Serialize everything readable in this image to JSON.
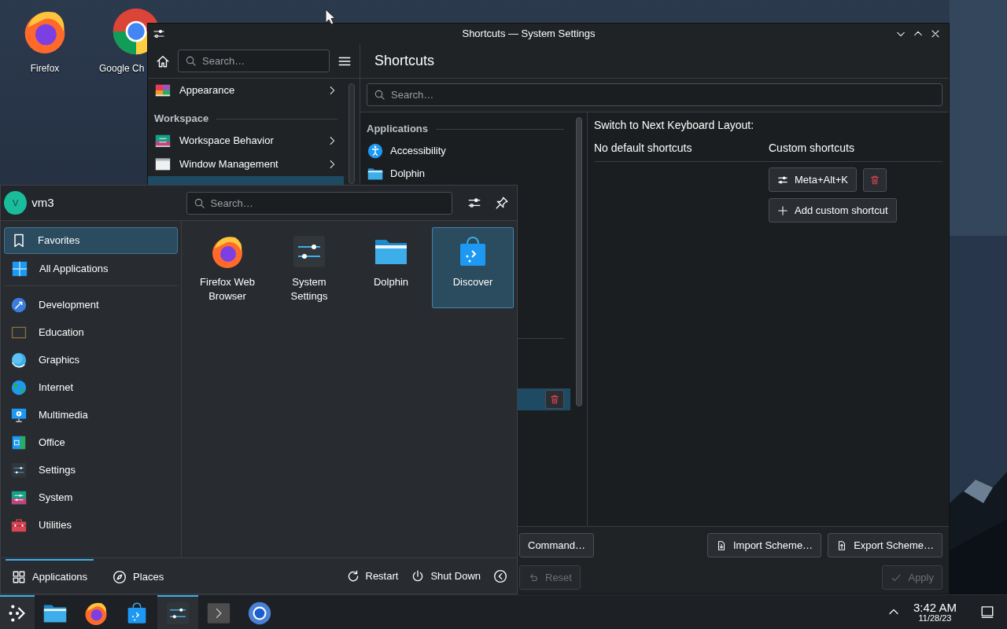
{
  "desktop_icons": [
    {
      "label": "Firefox"
    },
    {
      "label": "Google Ch"
    }
  ],
  "settings": {
    "title": "Shortcuts — System Settings",
    "sidebar": {
      "search": {
        "placeholder": "Search…"
      },
      "items": [
        {
          "kind": "item",
          "label": "Appearance",
          "selected": false
        },
        {
          "kind": "header",
          "label": "Workspace"
        },
        {
          "kind": "item",
          "label": "Workspace Behavior",
          "selected": false
        },
        {
          "kind": "item",
          "label": "Window Management",
          "selected": false
        },
        {
          "kind": "item",
          "selected": true
        }
      ]
    },
    "page_title": "Shortcuts",
    "search": {
      "placeholder": "Search…"
    },
    "components": [
      {
        "kind": "header",
        "label": "Applications"
      },
      {
        "kind": "app",
        "label": "Accessibility",
        "selected": false
      },
      {
        "kind": "app",
        "label": "Dolphin",
        "selected": false
      },
      {
        "kind": "header"
      },
      {
        "kind": "shortcut",
        "selected": true
      }
    ],
    "details": {
      "title": "Switch to Next Keyboard Layout:",
      "default_heading": "No default shortcuts",
      "custom_heading": "Custom shortcuts",
      "shortcuts": [
        {
          "keys": "Meta+Alt+K"
        }
      ],
      "add_label": "Add custom shortcut"
    },
    "footer": [
      {
        "kind": "left",
        "label": "Command…",
        "disabled": false
      },
      {
        "kind": "import",
        "label": "Import Scheme…",
        "disabled": false
      },
      {
        "kind": "export",
        "label": "Export Scheme…",
        "disabled": false
      },
      {
        "kind": "reset",
        "label": "Reset",
        "disabled": true
      },
      {
        "kind": "apply",
        "label": "Apply",
        "disabled": true
      }
    ]
  },
  "launcher": {
    "user": {
      "initial": "V",
      "name": "vm3"
    },
    "search": {
      "placeholder": "Search…"
    },
    "views": [
      {
        "label": "Favorites",
        "selected": true
      },
      {
        "label": "All Applications",
        "selected": false
      }
    ],
    "categories": [
      {
        "label": "Development"
      },
      {
        "label": "Education"
      },
      {
        "label": "Graphics"
      },
      {
        "label": "Internet"
      },
      {
        "label": "Multimedia"
      },
      {
        "label": "Office"
      },
      {
        "label": "Settings"
      },
      {
        "label": "System"
      },
      {
        "label": "Utilities"
      }
    ],
    "apps": [
      {
        "label": "Firefox Web Browser",
        "selected": false
      },
      {
        "label": "System Settings",
        "selected": false
      },
      {
        "label": "Dolphin",
        "selected": false
      },
      {
        "label": "Discover",
        "selected": true
      }
    ],
    "tabs": [
      {
        "label": "Applications",
        "selected": true
      },
      {
        "label": "Places",
        "selected": false
      }
    ],
    "power": [
      {
        "label": "Restart"
      },
      {
        "label": "Shut Down"
      }
    ]
  },
  "taskbar": {
    "items": [
      {
        "active": true
      },
      {
        "active": false
      },
      {
        "active": false
      },
      {
        "active": false
      },
      {
        "active": true
      },
      {
        "active": false
      },
      {
        "active": false
      }
    ],
    "clock": {
      "time": "3:42 AM",
      "date": "11/28/23"
    }
  }
}
